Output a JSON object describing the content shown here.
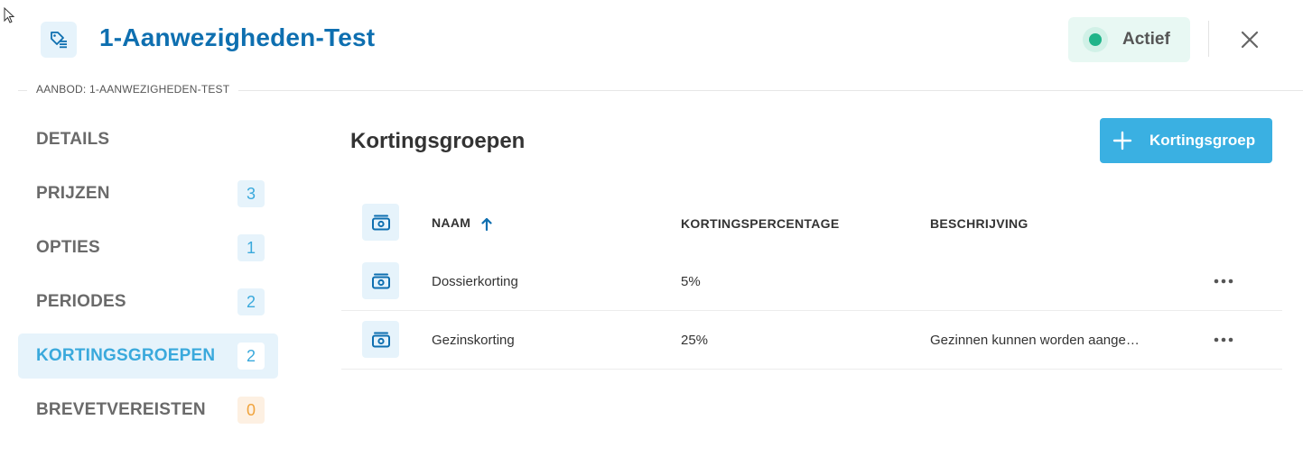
{
  "header": {
    "title": "1-Aanwezigheden-Test",
    "status_label": "Actief",
    "status_color": "#1fb489",
    "accent_color": "#0e6fb0"
  },
  "breadcrumb": "AANBOD: 1-AANWEZIGHEDEN-TEST",
  "sidebar": {
    "items": [
      {
        "label": "DETAILS",
        "count": ""
      },
      {
        "label": "PRIJZEN",
        "count": "3"
      },
      {
        "label": "OPTIES",
        "count": "1"
      },
      {
        "label": "PERIODES",
        "count": "2"
      },
      {
        "label": "KORTINGSGROEPEN",
        "count": "2"
      },
      {
        "label": "BREVETVEREISTEN",
        "count": "0"
      }
    ],
    "active_index": 4
  },
  "main": {
    "section_title": "Kortingsgroepen",
    "add_button_label": "Kortingsgroep",
    "table": {
      "headers": {
        "name": "NAAM",
        "percentage": "KORTINGSPERCENTAGE",
        "description": "BESCHRIJVING"
      },
      "sort_column": "NAAM",
      "sort_direction": "ascending",
      "rows": [
        {
          "name": "Dossierkorting",
          "percentage": "5%",
          "description": ""
        },
        {
          "name": "Gezinskorting",
          "percentage": "25%",
          "description": "Gezinnen kunnen worden aange…"
        }
      ]
    }
  }
}
